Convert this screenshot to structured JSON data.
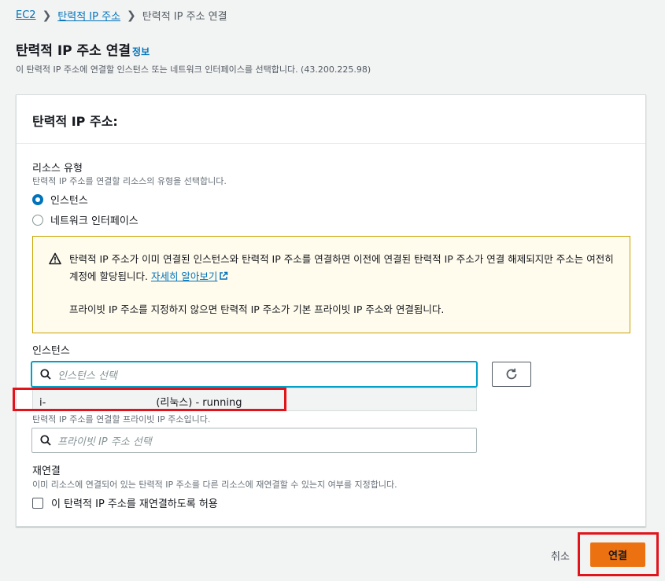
{
  "breadcrumb": {
    "root": "EC2",
    "parent": "탄력적 IP 주소",
    "current": "탄력적 IP 주소 연결"
  },
  "page": {
    "title": "탄력적 IP 주소 연결",
    "info": "정보",
    "description": "이 탄력적 IP 주소에 연결할 인스턴스 또는 네트워크 인터페이스를 선택합니다. (43.200.225.98)"
  },
  "panel": {
    "title": "탄력적 IP 주소: "
  },
  "resource_type": {
    "label": "리소스 유형",
    "description": "탄력적 IP 주소를 연결할 리소스의 유형을 선택합니다.",
    "options": [
      "인스턴스",
      "네트워크 인터페이스"
    ],
    "selected": "인스턴스"
  },
  "alert": {
    "line1": "탄력적 IP 주소가 이미 연결된 인스턴스와 탄력적 IP 주소를 연결하면 이전에 연결된 탄력적 IP 주소가 연결 해제되지만 주소는 여전히 계정에 할당됩니다.",
    "link": "자세히 알아보기",
    "line2": "프라이빗 IP 주소를 지정하지 않으면 탄력적 IP 주소가 기본 프라이빗 IP 주소와 연결됩니다."
  },
  "instance": {
    "label": "인스턴스",
    "placeholder": "인스턴스 선택",
    "dropdown_prefix": "i-",
    "dropdown_suffix": "(리눅스) - running"
  },
  "private_ip": {
    "description": "탄력적 IP 주소를 연결할 프라이빗 IP 주소입니다.",
    "placeholder": "프라이빗 IP 주소 선택"
  },
  "reassociation": {
    "label": "재연결",
    "description": "이미 리소스에 연결되어 있는 탄력적 IP 주소를 다른 리소스에 재연결할 수 있는지 여부를 지정합니다.",
    "checkbox": "이 탄력적 IP 주소를 재연결하도록 허용",
    "checked": false
  },
  "actions": {
    "cancel": "취소",
    "connect": "연결"
  },
  "colors": {
    "primary": "#ec7211",
    "link": "#0073bb",
    "highlight": "#e1141c",
    "warning_bg": "#fffbed"
  }
}
